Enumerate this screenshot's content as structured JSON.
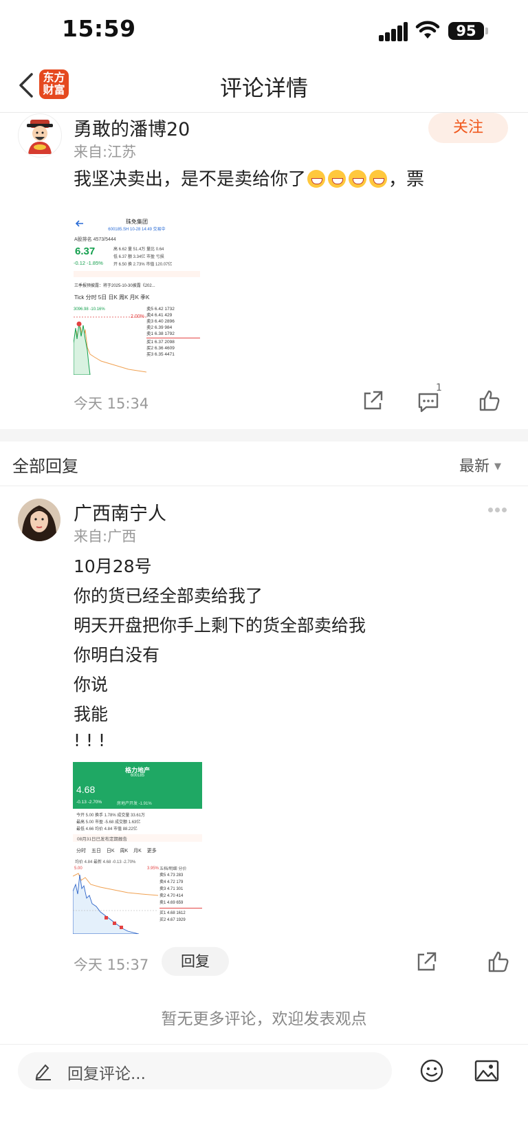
{
  "status_bar": {
    "time": "15:59",
    "battery": "95"
  },
  "header": {
    "title": "评论详情",
    "logo_line1": "东方",
    "logo_line2": "财富"
  },
  "post": {
    "author": "勇敢的潘博20",
    "location": "来自:江苏",
    "follow_label": "关注",
    "text_before": "我坚决卖出，是不是卖给你了",
    "text_after": "，票",
    "time": "今天 15:34",
    "comment_count": "1",
    "screenshot": {
      "name": "珠免集团",
      "code": "600185.SH 10-28 14:49 交易中",
      "rank": "A股排名 4573/5444",
      "price": "6.37",
      "change": "-0.12 -1.85%",
      "stats_row1": "高 6.62 量 51.4万 量比 0.64",
      "stats_row2": "低 6.37 额 3.34亿 市盈 亏损",
      "stats_row3": "开 6.50 换 2.73% 市值 120.07亿",
      "tabs": "Tick 分时 5日 日K 周K 月K 季K",
      "sells": [
        "卖5 6.42 1732",
        "卖4 6.41 429",
        "卖3 6.40 2896",
        "卖2 6.39 984",
        "卖1 6.38 1792"
      ],
      "buys": [
        "买1 6.37 2098",
        "买2 6.36 4609",
        "买3 6.35 4471"
      ],
      "index_label": "3096.98 -10.16%",
      "pct_label": "2.00%",
      "news": "三季报预披露：将于2025-10-30披露《202..."
    }
  },
  "replies_section": {
    "title": "全部回复",
    "sort": "最新"
  },
  "reply": {
    "author": "广西南宁人",
    "location": "来自:广西",
    "lines": [
      "10月28号",
      "你的货已经全部卖给我了",
      "明天开盘把你手上剩下的货全部卖给我",
      "你明白没有",
      "你说",
      "我能",
      "! ! !"
    ],
    "time": "今天 15:37",
    "reply_label": "回复",
    "screenshot": {
      "name": "格力地产",
      "code": "600185",
      "price": "4.68",
      "change": "-0.13 -2.70%",
      "sector": "房地产开发 -1.91%",
      "row1": "今开 5.00 换手 1.78% 成交量 33.61万",
      "row2": "最高 5.00 市盈 -5.68 成交额 1.63亿",
      "row3": "最低 4.66 均价 4.84 市值 88.22亿",
      "notice": "08月31日已发布定期报告",
      "tabs": "分时 五日 日K 周K 月K 更多",
      "avg": "均价 4.84 最新 4.68 -0.13 -2.70%",
      "top_left": "5.00",
      "top_right": "3.95%",
      "book_title": "五档/明细  分价",
      "sells": [
        "卖5 4.73 283",
        "卖4 4.72 179",
        "卖3 4.71 301",
        "卖2 4.70 414",
        "卖1 4.69 659"
      ],
      "buys": [
        "买1 4.68 1612",
        "买2 4.67 1929"
      ]
    }
  },
  "footer": {
    "no_more": "暂无更多评论，欢迎发表观点",
    "input_placeholder": "回复评论..."
  }
}
